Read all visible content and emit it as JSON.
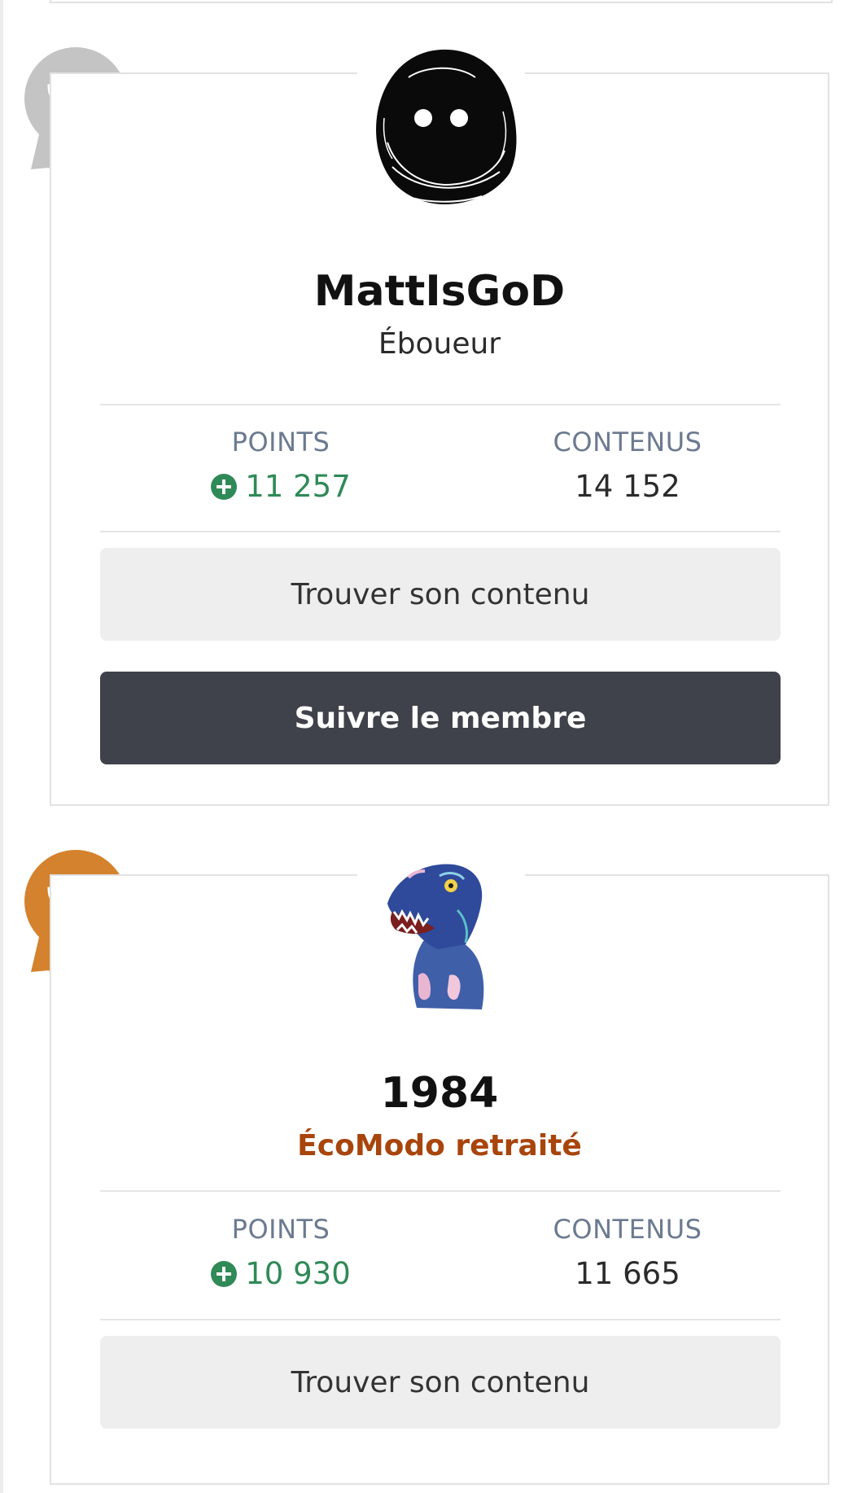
{
  "members": [
    {
      "username": "MattIsGoD",
      "rank": "Éboueur",
      "rank_highlight": false,
      "award_color": "#c4c4c4",
      "avatar": "hooded-figure-avatar",
      "points_label": "POINTS",
      "points_value": "11 257",
      "content_label": "CONTENUS",
      "content_value": "14 152",
      "find_content_label": "Trouver son contenu",
      "follow_label": "Suivre le membre"
    },
    {
      "username": "1984",
      "rank": "ÉcoModo retraité",
      "rank_highlight": true,
      "rank_color": "#a8450c",
      "award_color": "#d4822e",
      "avatar": "raptor-avatar",
      "points_label": "POINTS",
      "points_value": "10 930",
      "content_label": "CONTENUS",
      "content_value": "11 665",
      "find_content_label": "Trouver son contenu"
    }
  ],
  "colors": {
    "positive": "#2f8a57",
    "label": "#6b7a90",
    "dark_button": "#3f424a",
    "light_button": "#eeeeee"
  }
}
